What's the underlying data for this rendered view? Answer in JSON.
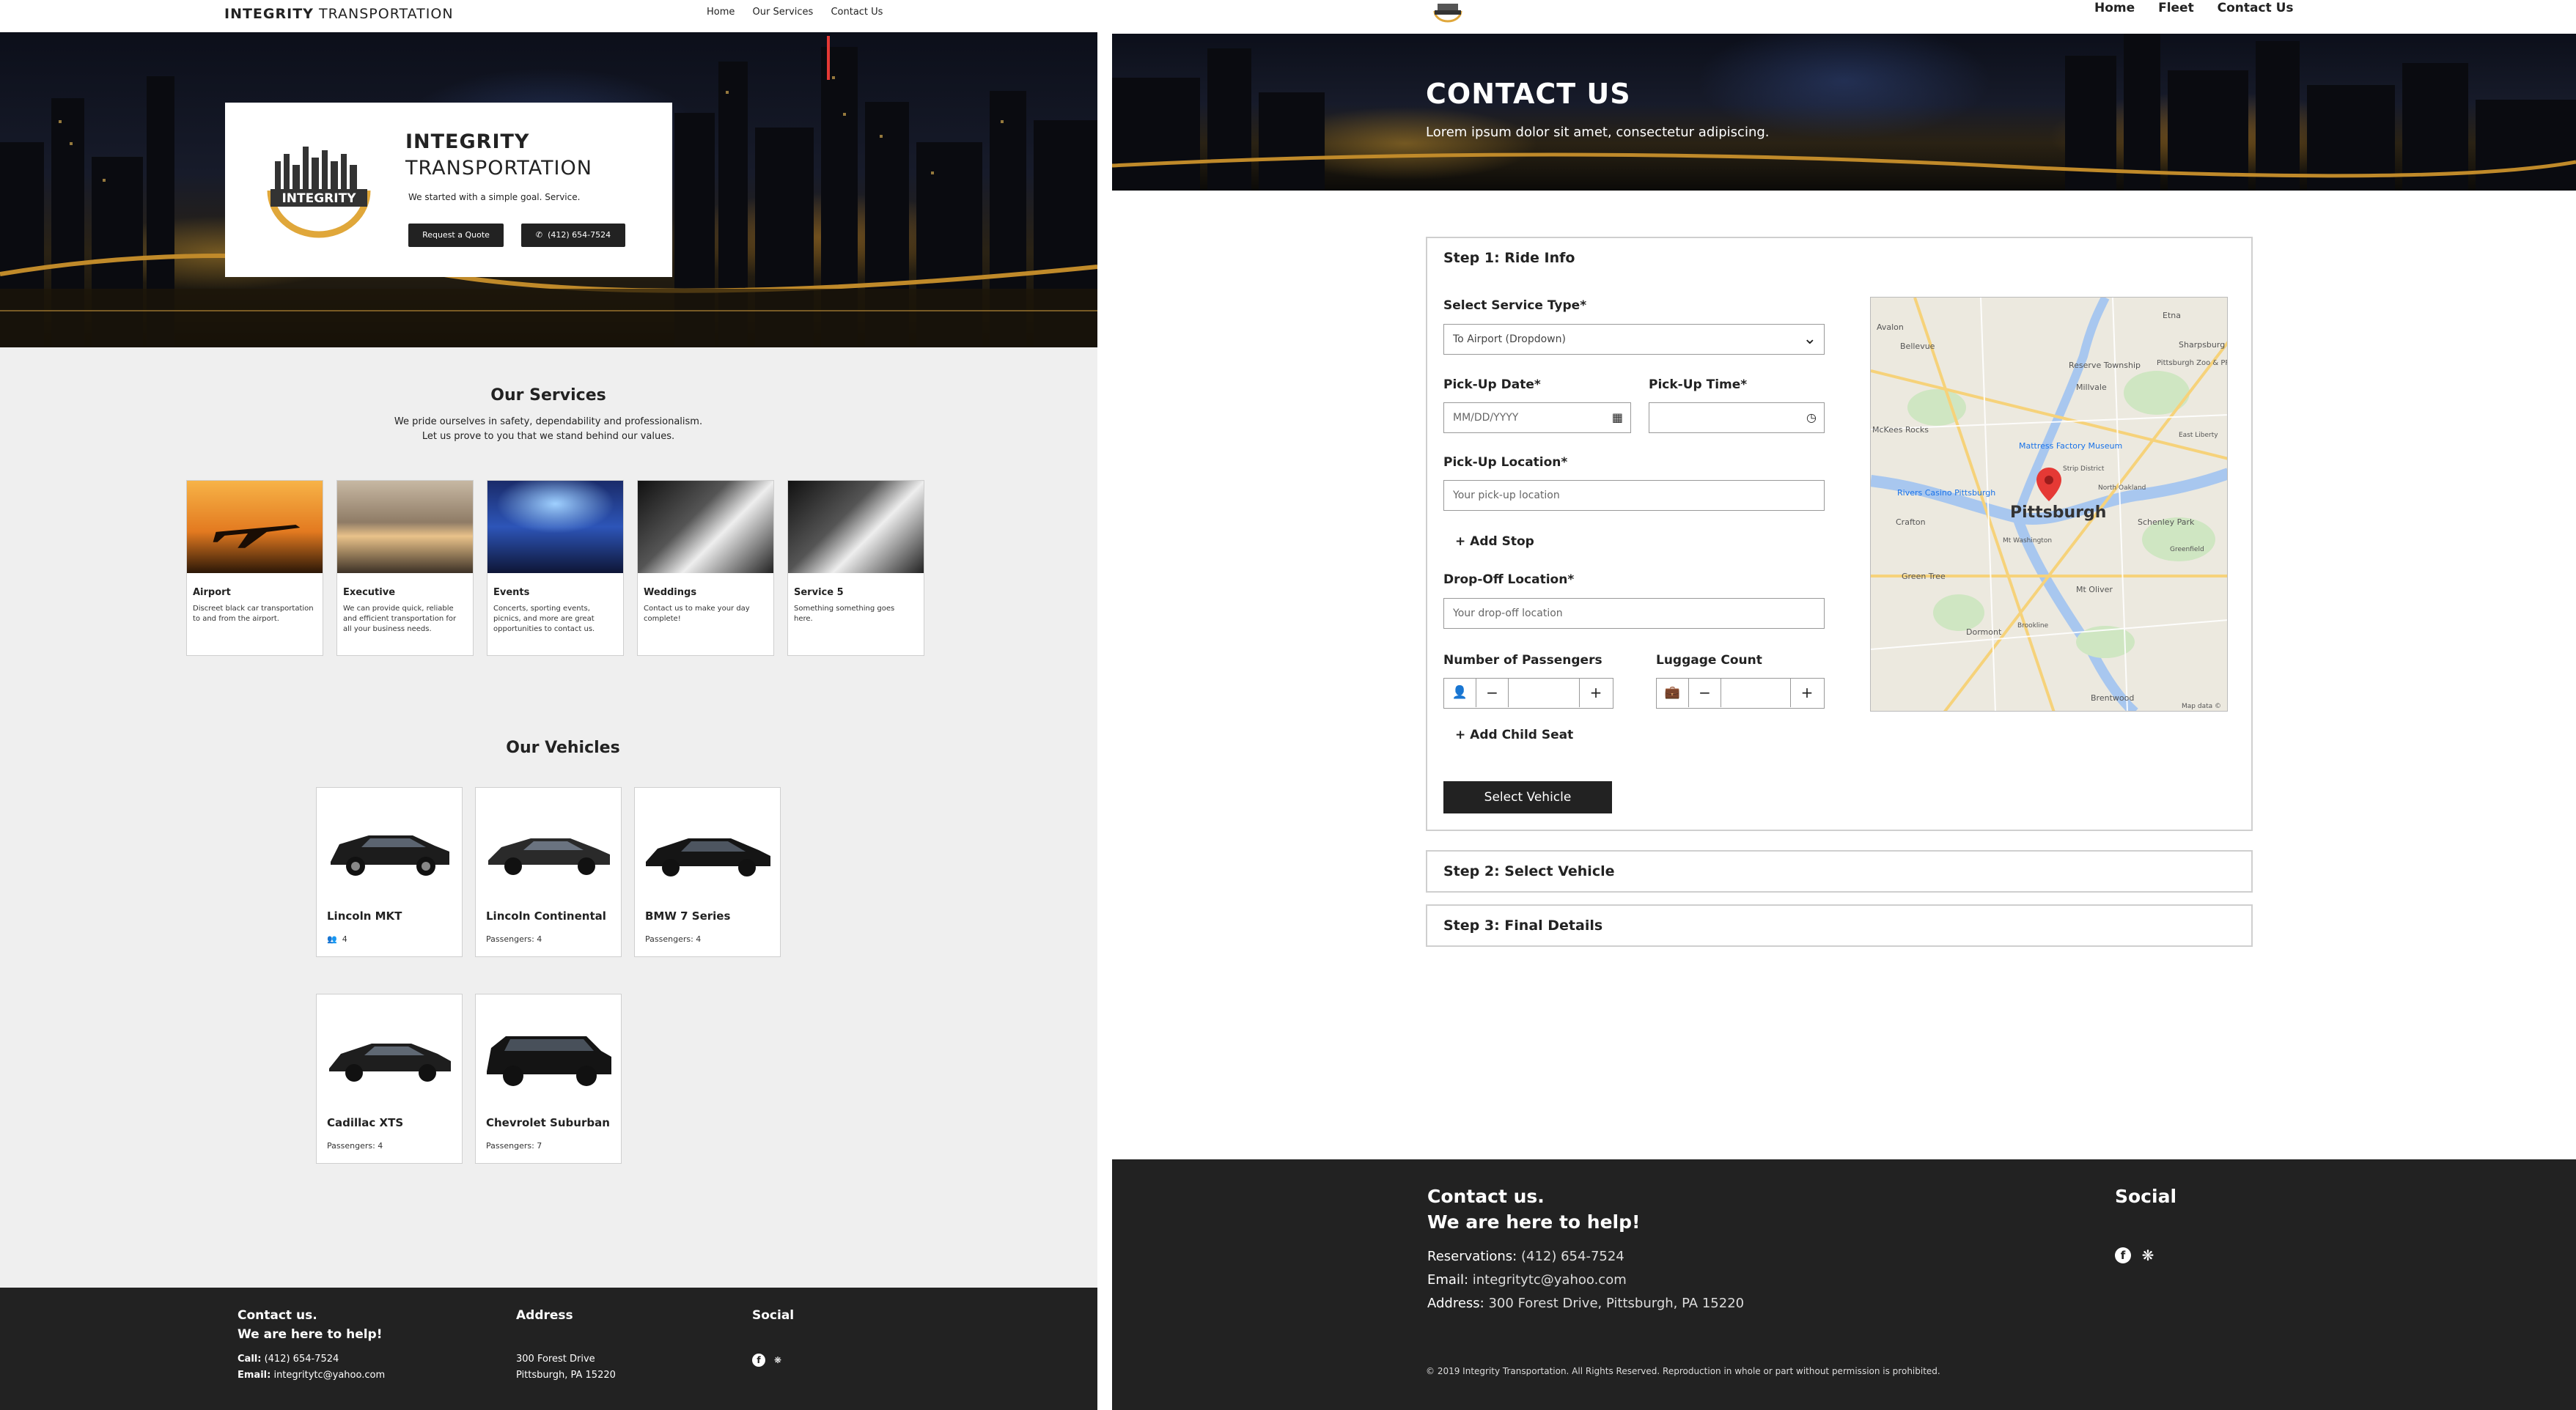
{
  "home": {
    "brand_bold": "INTEGRITY",
    "brand_light": "TRANSPORTATION",
    "nav": [
      "Home",
      "Our Services",
      "Contact Us"
    ],
    "hero": {
      "title_line1": "INTEGRITY",
      "title_line2": "TRANSPORTATION",
      "logo_text": "INTEGRITY",
      "subtitle": "We started with a simple goal.  Service.",
      "quote_button": "Request a Quote",
      "phone_button": "(412) 654-7524"
    },
    "services": {
      "title": "Our Services",
      "desc_line1": "We pride ourselves in safety, dependability and professionalism.",
      "desc_line2": "Let us prove to you that we stand behind our values.",
      "items": [
        {
          "name": "Airport",
          "desc": "Discreet black car transportation to and from the airport."
        },
        {
          "name": "Executive",
          "desc": "We can provide quick, reliable and efficient transportation for all your business needs."
        },
        {
          "name": "Events",
          "desc": "Concerts, sporting events, picnics, and more are great opportunities to contact us."
        },
        {
          "name": "Weddings",
          "desc": "Contact us to make your day complete!"
        },
        {
          "name": "Service 5",
          "desc": "Something something goes here."
        }
      ]
    },
    "vehicles": {
      "title": "Our Vehicles",
      "items": [
        {
          "name": "Lincoln MKT",
          "passengers": "4"
        },
        {
          "name": "Lincoln Continental",
          "passengers": "Passengers: 4"
        },
        {
          "name": "BMW 7 Series",
          "passengers": "Passengers: 4"
        },
        {
          "name": "Cadillac XTS",
          "passengers": "Passengers: 4"
        },
        {
          "name": "Chevrolet Suburban",
          "passengers": "Passengers: 7"
        }
      ]
    },
    "footer": {
      "contact_h1": "Contact us.",
      "contact_h2": "We are here to help!",
      "call_label": "Call:",
      "call_value": "(412) 654-7524",
      "email_label": "Email:",
      "email_value": "integritytc@yahoo.com",
      "address_h": "Address",
      "address_line1": "300 Forest Drive",
      "address_line2": "Pittsburgh, PA 15220",
      "social_h": "Social"
    }
  },
  "contact": {
    "nav": [
      "Home",
      "Fleet",
      "Contact Us"
    ],
    "hero_title": "CONTACT US",
    "hero_subtitle": "Lorem ipsum dolor sit amet, consectetur adipiscing.",
    "step1": {
      "title": "Step 1: Ride Info",
      "service_type_label": "Select Service Type*",
      "service_type_value": "To Airport (Dropdown)",
      "pickup_date_label": "Pick-Up Date*",
      "pickup_date_placeholder": "MM/DD/YYYY",
      "pickup_time_label": "Pick-Up Time*",
      "pickup_location_label": "Pick-Up Location*",
      "pickup_location_placeholder": "Your pick-up location",
      "add_stop": "+ Add Stop",
      "dropoff_label": "Drop-Off Location*",
      "dropoff_placeholder": "Your drop-off location",
      "passengers_label": "Number of Passengers",
      "luggage_label": "Luggage Count",
      "minus": "−",
      "plus": "+",
      "add_child_seat": "+ Add Child Seat",
      "select_vehicle": "Select Vehicle"
    },
    "map": {
      "city": "Pittsburgh",
      "labels": [
        "Avalon",
        "Bellevue",
        "Etna",
        "Sharpsburg",
        "Reserve Township",
        "Millvale",
        "Pittsburgh Zoo & PPG Aquarium",
        "McKees Rocks",
        "Mattress Factory Museum",
        "Rivers Casino Pittsburgh",
        "Strip District",
        "North Oakland",
        "East Liberty",
        "Crafton",
        "Schenley Park",
        "Mt Washington",
        "Green Tree",
        "Mt Oliver",
        "Dormont",
        "Brookline",
        "Brentwood",
        "Greenfield",
        "Map data ©"
      ]
    },
    "step2_title": "Step 2: Select Vehicle",
    "step3_title": "Step 3: Final Details",
    "footer": {
      "contact_h1": "Contact us.",
      "contact_h2": "We are here to help!",
      "reservations_label": "Reservations:",
      "reservations_value": "(412) 654-7524",
      "email_label": "Email:",
      "email_value": "integritytc@yahoo.com",
      "address_label": "Address:",
      "address_value": "300 Forest Drive, Pittsburgh, PA 15220",
      "social_h": "Social",
      "copyright": "© 2019 Integrity Transportation. All Rights Reserved. Reproduction in whole or part without permission is prohibited."
    }
  },
  "colors": {
    "dark": "#222222",
    "card_border": "#cfcfcf",
    "page_bg": "#efefef",
    "logo_gold": "#e0a73a"
  }
}
